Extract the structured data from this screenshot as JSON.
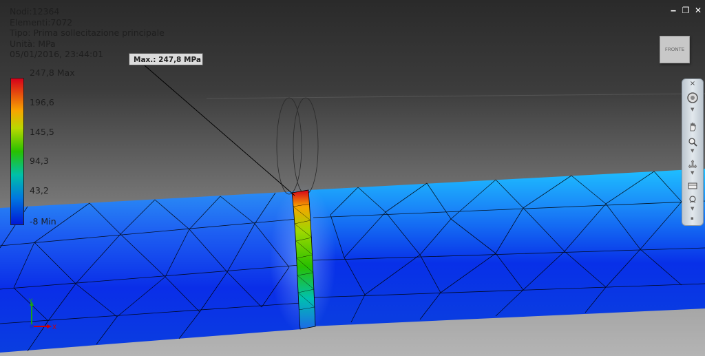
{
  "info": {
    "nodes": "Nodi:12364",
    "elements": "Elementi:7072",
    "type": "Tipo: Prima sollecitazione principale",
    "unit": "Unità: MPa",
    "timestamp": "05/01/2016, 23:44:01"
  },
  "legend": {
    "labels": [
      "247,8 Max",
      "196,6",
      "145,5",
      "94,3",
      "43,2",
      "-8 Min"
    ]
  },
  "probe": {
    "label": "Max.: 247,8 MPa"
  },
  "window_controls": {
    "minimize": "‒",
    "restore": "❐",
    "close": "✕"
  },
  "viewcube": {
    "face": "FRONTE"
  },
  "navbar": {
    "close": "×",
    "tools": [
      "steering-wheel",
      "pan",
      "zoom",
      "orbit",
      "look-at",
      "orbit-center"
    ]
  },
  "triad": {
    "x": "X",
    "y": "Y"
  },
  "colors": {
    "max": "#d6001a",
    "min": "#0018d8",
    "model_blue": "#1a5cf0"
  }
}
